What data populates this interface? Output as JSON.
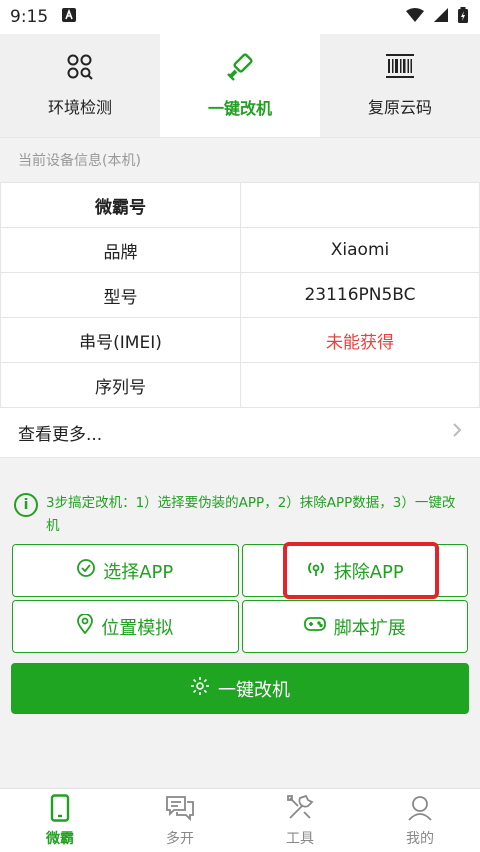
{
  "status_bar": {
    "time": "9:15"
  },
  "top_tabs": [
    {
      "label": "环境检测",
      "icon": "four-circles-search-icon"
    },
    {
      "label": "一键改机",
      "icon": "paint-roller-icon"
    },
    {
      "label": "复原云码",
      "icon": "barcode-icon"
    }
  ],
  "device_info": {
    "title": "当前设备信息(本机)",
    "rows": [
      {
        "key": "微霸号",
        "value": ""
      },
      {
        "key": "品牌",
        "value": "Xiaomi"
      },
      {
        "key": "型号",
        "value": "23116PN5BC"
      },
      {
        "key": "串号(IMEI)",
        "value": "未能获得"
      },
      {
        "key": "序列号",
        "value": ""
      }
    ],
    "more_label": "查看更多..."
  },
  "tip": {
    "text": "3步搞定改机：1）选择要伪装的APP，2）抹除APP数据，3）一键改机"
  },
  "actions": {
    "select_app": "选择APP",
    "erase_app": "抹除APP",
    "location_sim": "位置模拟",
    "script_ext": "脚本扩展",
    "one_key": "一键改机"
  },
  "bottom_nav": [
    {
      "label": "微霸",
      "icon": "phone-icon"
    },
    {
      "label": "多开",
      "icon": "chat-icon"
    },
    {
      "label": "工具",
      "icon": "tools-icon"
    },
    {
      "label": "我的",
      "icon": "person-icon"
    }
  ],
  "colors": {
    "accent": "#21a121",
    "warning": "#e64340",
    "highlight_box": "#e0262a"
  }
}
